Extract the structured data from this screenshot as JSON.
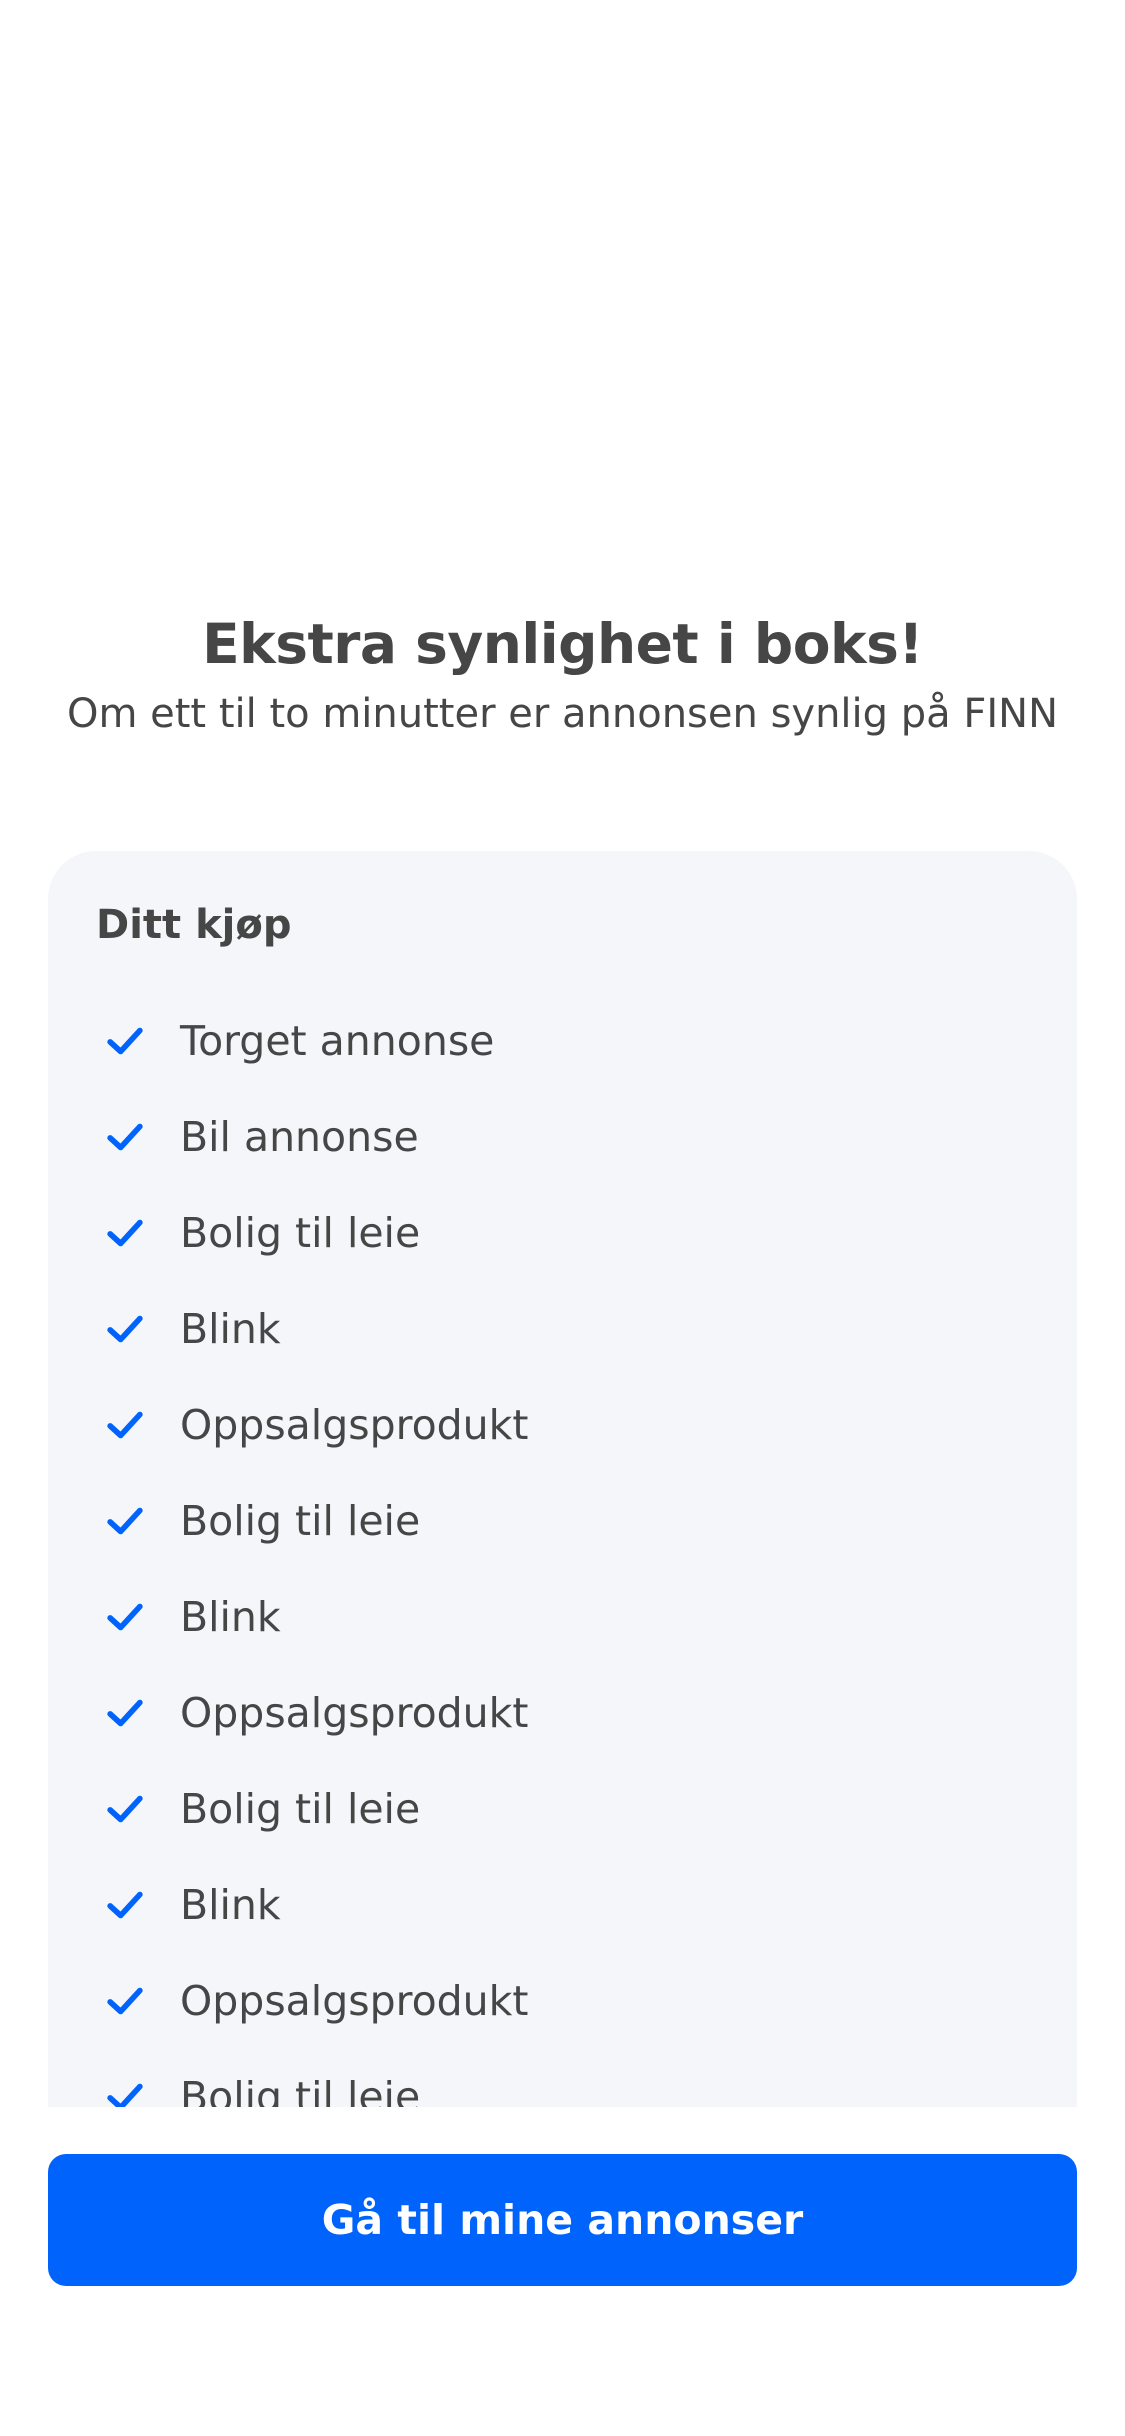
{
  "header": {
    "title": "Ekstra synlighet i boks!",
    "subtitle": "Om ett til to minutter er annonsen synlig på FINN"
  },
  "purchase": {
    "heading": "Ditt kjøp",
    "check_icon": "checkmark-icon",
    "check_color": "#0063fb",
    "items": [
      {
        "label": "Torget annonse"
      },
      {
        "label": "Bil annonse"
      },
      {
        "label": "Bolig til leie"
      },
      {
        "label": "Blink"
      },
      {
        "label": "Oppsalgsprodukt"
      },
      {
        "label": "Bolig til leie"
      },
      {
        "label": "Blink"
      },
      {
        "label": "Oppsalgsprodukt"
      },
      {
        "label": "Bolig til leie"
      },
      {
        "label": "Blink"
      },
      {
        "label": "Oppsalgsprodukt"
      },
      {
        "label": "Bolig til leie"
      }
    ]
  },
  "cta": {
    "label": "Gå til mine annonser",
    "color": "#0063fb"
  }
}
